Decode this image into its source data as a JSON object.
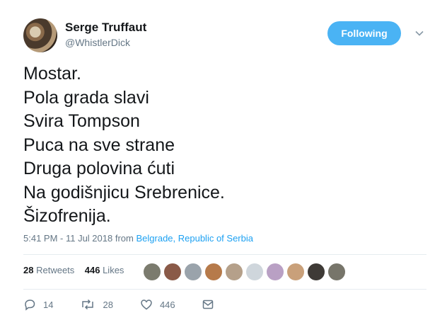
{
  "author": {
    "name": "Serge Truffaut",
    "handle": "@WhistlerDick"
  },
  "follow_button": "Following",
  "tweet": {
    "lines": [
      "Mostar.",
      "Pola grada slavi",
      "Svira Tompson",
      "Puca na sve strane",
      "Druga polovina ćuti",
      "Na godišnjicu Srebrenice.",
      "Šizofrenija."
    ]
  },
  "meta": {
    "time": "5:41 PM - 11 Jul 2018",
    "from_text": "from",
    "location": "Belgrade, Republic of Serbia"
  },
  "stats": {
    "retweets": "28",
    "retweets_label": "Retweets",
    "likes": "446",
    "likes_label": "Likes"
  },
  "liker_avatars": [
    "#7b7b6e",
    "#8a5a48",
    "#9aa3ab",
    "#b67a4a",
    "#b5a08a",
    "#cfd6dc",
    "#b9a0c4",
    "#c9a07a",
    "#3e3a36",
    "#77756a"
  ],
  "actions": {
    "replies": "14",
    "retweets": "28",
    "likes": "446"
  },
  "icons": {
    "dropdown": "chevron-down-icon",
    "reply": "reply-icon",
    "retweet": "retweet-icon",
    "like": "heart-icon",
    "dm": "envelope-icon"
  },
  "colors": {
    "accent": "#1da1f2",
    "follow_bg": "#4ab3f4",
    "muted": "#657786"
  }
}
